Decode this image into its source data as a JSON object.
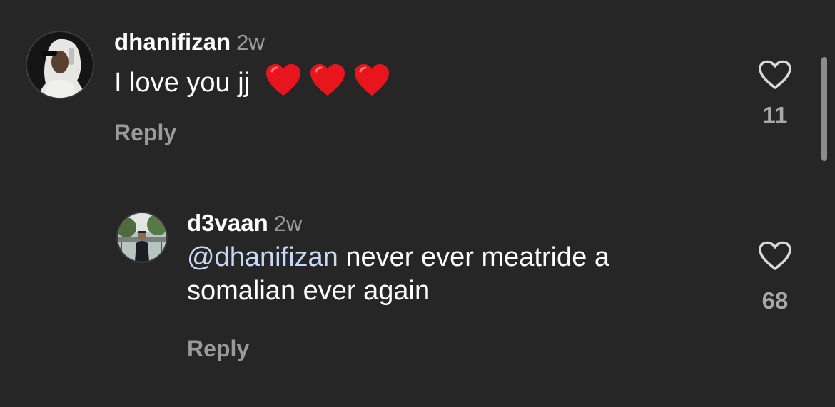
{
  "comments": [
    {
      "username": "dhanifizan",
      "time": "2w",
      "text": "I love you jj",
      "reply_label": "Reply",
      "like_count": "11",
      "avatar_icon": "avatar-person-white-hoodie-headphones"
    },
    {
      "username": "d3vaan",
      "time": "2w",
      "mention": "@dhanifizan",
      "text": " never ever meatride a",
      "text_line2": "somalian ever again",
      "reply_label": "Reply",
      "like_count": "68",
      "avatar_icon": "avatar-person-suit-outdoors"
    }
  ],
  "icons": {
    "like": "heart-outline-icon",
    "emoji": "red-heart-emoji"
  },
  "colors": {
    "background": "#262626",
    "mention": "#c7d9f5",
    "secondary_text": "#9a9a9a",
    "emoji_heart": "#e8161c"
  }
}
